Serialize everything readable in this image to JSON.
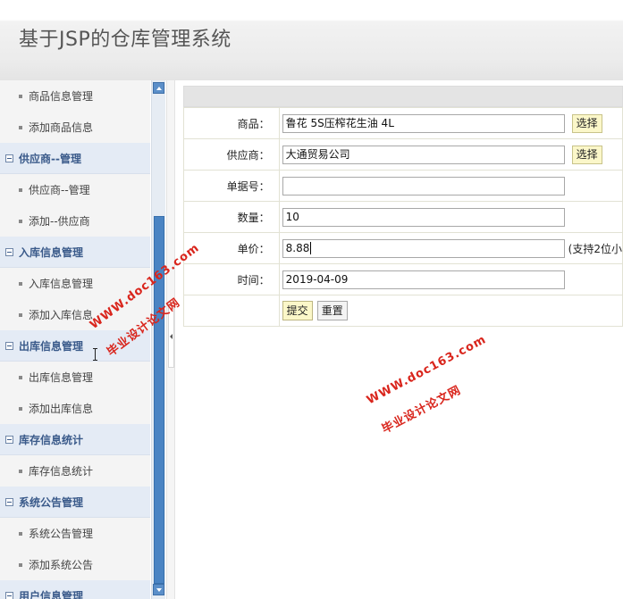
{
  "app": {
    "title": "基于JSP的仓库管理系统"
  },
  "sidebar": {
    "top_items": [
      "商品信息管理",
      "添加商品信息"
    ],
    "groups": [
      {
        "label": "供应商--管理",
        "items": [
          "供应商--管理",
          "添加--供应商"
        ]
      },
      {
        "label": "入库信息管理",
        "items": [
          "入库信息管理",
          "添加入库信息"
        ]
      },
      {
        "label": "出库信息管理",
        "items": [
          "出库信息管理",
          "添加出库信息"
        ]
      },
      {
        "label": "库存信息统计",
        "items": [
          "库存信息统计"
        ]
      },
      {
        "label": "系统公告管理",
        "items": [
          "系统公告管理",
          "添加系统公告"
        ]
      },
      {
        "label": "用户信息管理",
        "items": []
      }
    ]
  },
  "form": {
    "product_label": "商品：",
    "product_value": "鲁花 5S压榨花生油 4L",
    "supplier_label": "供应商：",
    "supplier_value": "大通贸易公司",
    "doc_no_label": "单据号：",
    "doc_no_value": "",
    "quantity_label": "数量：",
    "quantity_value": "10",
    "price_label": "单价：",
    "price_value": "8.88",
    "price_hint": "(支持2位小",
    "date_label": "时间：",
    "date_value": "2019-04-09",
    "select_label": "选择",
    "submit_label": "提交",
    "reset_label": "重置"
  },
  "watermark": {
    "url": "WWW.doc163.com",
    "text": "毕业设计论文网"
  },
  "colors": {
    "group_header_bg": "#e4ebf5",
    "group_header_text": "#3a5a8a",
    "scrollbar": "#4a84c3",
    "button_yellow": "#fbf7c9",
    "watermark": "#d9251c"
  }
}
